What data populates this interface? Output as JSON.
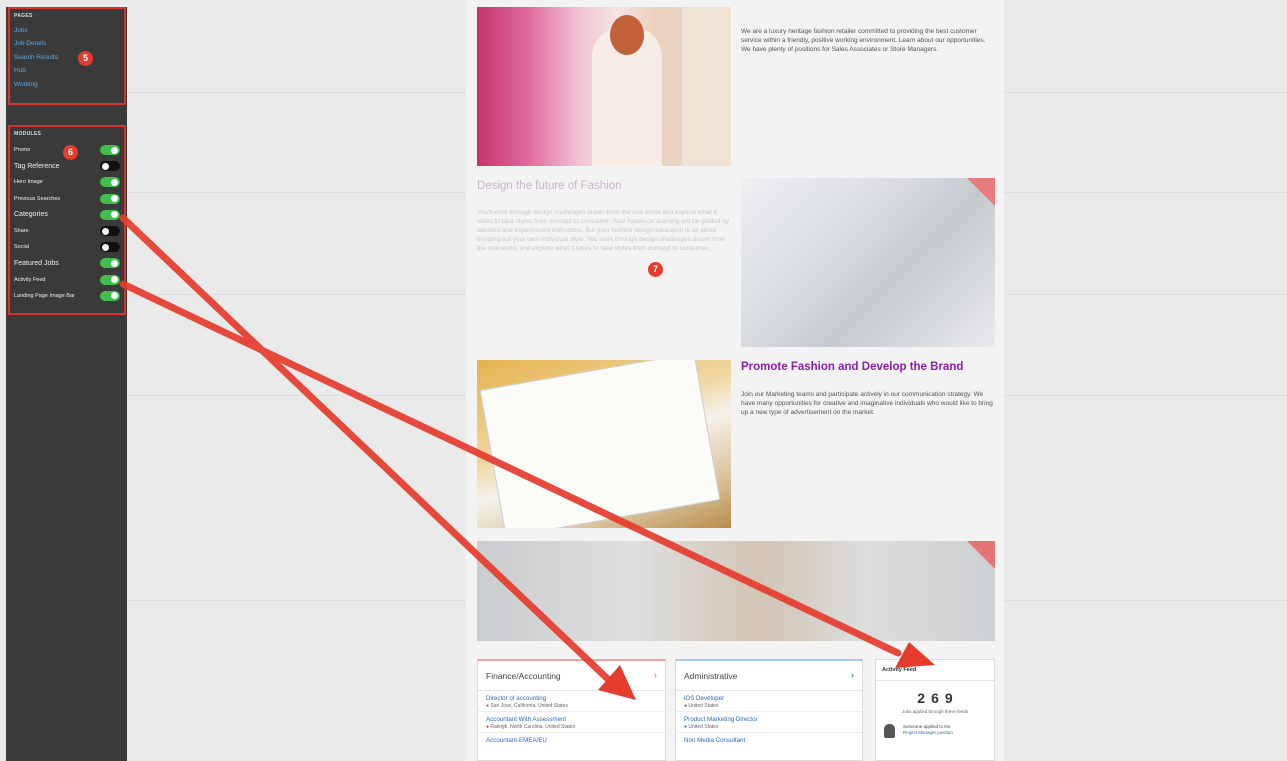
{
  "sidebar": {
    "pages": {
      "title": "PAGES",
      "badge": "5",
      "items": [
        "Jobs",
        "Job Details",
        "Search Results",
        "Hub",
        "Working"
      ]
    },
    "modules": {
      "title": "MODULES",
      "badge": "6",
      "items": [
        {
          "label": "Promo",
          "on": true
        },
        {
          "label": "Tag Reference",
          "on": false
        },
        {
          "label": "Hero Image",
          "on": true
        },
        {
          "label": "Previous Searches",
          "on": true
        },
        {
          "label": "Categories",
          "on": true
        },
        {
          "label": "Share",
          "on": false
        },
        {
          "label": "Social",
          "on": false
        },
        {
          "label": "Featured Jobs",
          "on": true
        },
        {
          "label": "Activity Feed",
          "on": true
        },
        {
          "label": "Landing Page Image Bar",
          "on": true
        }
      ]
    }
  },
  "content": {
    "intro": {
      "text": "We are a luxury heritage fashion retailer committed to providing the best customer service within a friendly, positive working environment. Learn about our opportunities. We have plenty of positions for Sales Associates or Store Managers."
    },
    "design": {
      "heading": "Design the future of Fashion",
      "text": "You'll work through design challenges drawn from the real world and explore what it takes to take styles from concept to consumer. Your hands-on learning will be guided by talented and experienced instructors. But your fashion design education is all about bringing out your own individual style. You work through design challenges drawn from the real world, and explore what it takes to take styles from concept to consumer...",
      "badge": "7"
    },
    "promote": {
      "heading": "Promote Fashion and Develop the Brand",
      "text": "Join our Marketing teams and participate actively in our communication strategy. We have many opportunities for creative and imaginative individuals who would like to bring up a new type of advertisement on the market."
    }
  },
  "cards": {
    "finance": {
      "title": "Finance/Accounting",
      "jobs": [
        {
          "title": "Director of accounting",
          "location": "San Jose, California, United States"
        },
        {
          "title": "Accountant With Assessment",
          "location": "Raleigh, North Carolina, United States"
        },
        {
          "title": "Accountant-EMEA/EU"
        }
      ]
    },
    "admin": {
      "title": "Administrative",
      "jobs": [
        {
          "title": "iOS Developer",
          "location": "United States"
        },
        {
          "title": "Product Marketing Director",
          "location": "United States"
        },
        {
          "title": "Non Media Consultant"
        }
      ]
    },
    "activity": {
      "title": "Activity Feed",
      "digits": [
        "2",
        "6",
        "9"
      ],
      "sub": "Jobs applied through these feeds",
      "item_text": "Someone applied to the",
      "item_link": "Project Manager position"
    }
  },
  "colors": {
    "accent_red": "#d8342b",
    "toggle_on": "#3fbf4a",
    "heading_purple": "#8a1fa8",
    "link_blue": "#2b6cb5"
  }
}
